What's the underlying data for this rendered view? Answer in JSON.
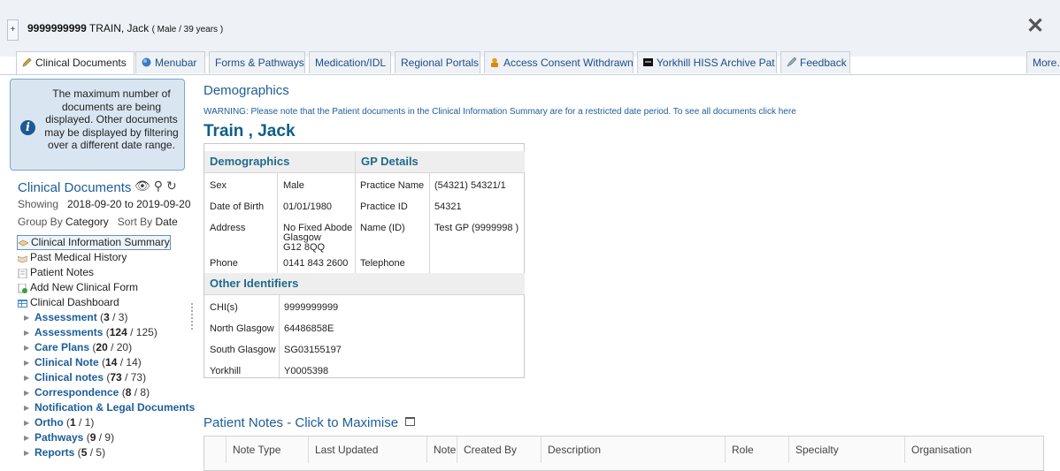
{
  "header": {
    "chi": "9999999999",
    "name": "TRAIN, Jack",
    "meta": "( Male / 39 years )",
    "collapse_icon": "+",
    "close_icon": "✕"
  },
  "tabs": [
    {
      "label": "Clinical Documents",
      "icon": "pencil-icon"
    },
    {
      "label": "Menubar",
      "icon": "globe-icon"
    },
    {
      "label": "Forms & Pathways"
    },
    {
      "label": "Medication/IDL"
    },
    {
      "label": "Regional Portals"
    },
    {
      "label": "Access Consent Withdrawn",
      "icon": "user-lock-icon"
    },
    {
      "label": "Yorkhill HISS Archive Pat",
      "icon": "archive-icon"
    },
    {
      "label": "Feedback",
      "icon": "pen-icon"
    },
    {
      "label": "More."
    }
  ],
  "sidebar": {
    "info": "The maximum number of documents are being displayed. Other documents may be displayed by filtering over a different date range.",
    "title": "Clinical Documents",
    "showing_label": "Showing",
    "showing_range": "2018-09-20 to 2019-09-20",
    "groupby_label": "Group By",
    "groupby_value": "Category",
    "sortby_label": "Sort By",
    "sortby_value": "Date",
    "nav": [
      "Clinical Information Summary",
      "Past Medical History",
      "Patient Notes",
      "Add New Clinical Form",
      "Clinical Dashboard"
    ],
    "categories": [
      {
        "name": "Assessment",
        "shown": "3",
        "total": "/ 3"
      },
      {
        "name": "Assessments",
        "shown": "124",
        "total": "/ 125"
      },
      {
        "name": "Care Plans",
        "shown": "20",
        "total": "/ 20"
      },
      {
        "name": "Clinical Note",
        "shown": "14",
        "total": "/ 14"
      },
      {
        "name": "Clinical notes",
        "shown": "73",
        "total": "/ 73"
      },
      {
        "name": "Correspondence",
        "shown": "8",
        "total": "/ 8"
      },
      {
        "name": "Notification & Legal Documents",
        "shown": "",
        "total": ""
      },
      {
        "name": "Ortho",
        "shown": "1",
        "total": "/ 1"
      },
      {
        "name": "Pathways",
        "shown": "9",
        "total": "/ 9"
      },
      {
        "name": "Reports",
        "shown": "5",
        "total": "/ 5"
      }
    ]
  },
  "main": {
    "heading": "Demographics",
    "warning": "WARNING: Please note that the Patient documents in the Clinical Information Summary are for a restricted date period. To see all documents click here",
    "patient_name": "Train , Jack",
    "demographics": {
      "title": "Demographics",
      "rows": [
        {
          "label": "Sex",
          "value": "Male"
        },
        {
          "label": "Date of Birth",
          "value": "01/01/1980"
        },
        {
          "label": "Address",
          "value_lines": [
            "No Fixed Abode",
            "Glasgow",
            "G12 8QQ"
          ]
        },
        {
          "label": "Phone",
          "value": "0141 843 2600"
        }
      ]
    },
    "gp": {
      "title": "GP Details",
      "rows": [
        {
          "label": "Practice Name",
          "value": "(54321) 54321/1"
        },
        {
          "label": "Practice ID",
          "value": "54321"
        },
        {
          "label": "Name (ID)",
          "value": "Test GP (9999998 )"
        },
        {
          "label": "Telephone",
          "value": ""
        }
      ]
    },
    "identifiers": {
      "title": "Other Identifiers",
      "rows": [
        {
          "label": "CHI(s)",
          "value": "9999999999"
        },
        {
          "label": "North Glasgow",
          "value": "64486858E"
        },
        {
          "label": "South Glasgow",
          "value": "SG03155197"
        },
        {
          "label": "Yorkhill",
          "value": "Y0005398"
        }
      ]
    },
    "patient_notes": {
      "heading": "Patient Notes - Click to Maximise",
      "columns": [
        "Note Type",
        "Last Updated",
        "Note",
        "Created By",
        "Description",
        "Role",
        "Specialty",
        "Organisation"
      ]
    }
  }
}
